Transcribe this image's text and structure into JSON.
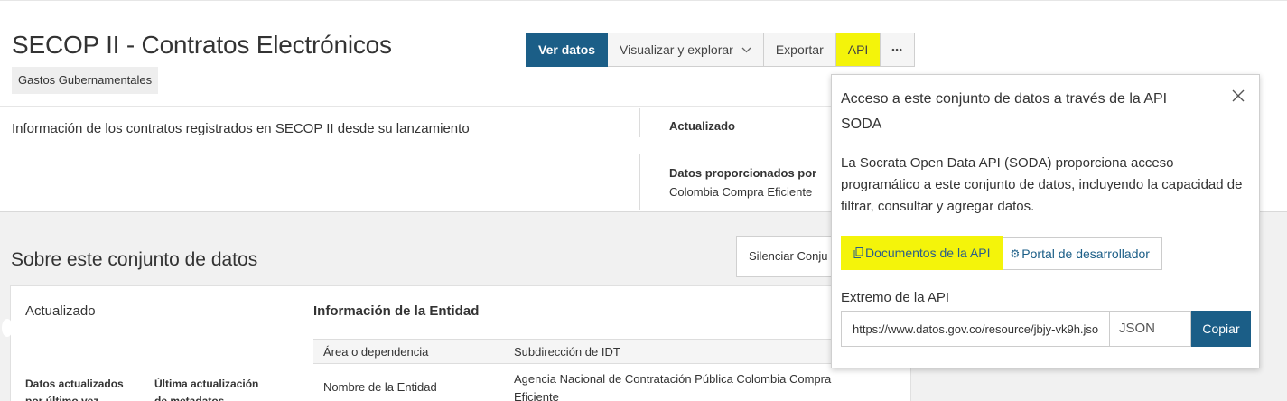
{
  "header": {
    "title": "SECOP II - Contratos Electrónicos",
    "category_tag": "Gastos Gubernamentales"
  },
  "toolbar": {
    "view_data": "Ver datos",
    "visualize": "Visualizar y explorar",
    "export": "Exportar",
    "api": "API",
    "more": "•••"
  },
  "summary": {
    "description": "Información de los contratos registrados en SECOP II desde su lanzamiento",
    "updated_label": "Actualizado",
    "provided_by_label": "Datos proporcionados por",
    "provided_by_value": "Colombia Compra Eficiente"
  },
  "about": {
    "title": "Sobre este conjunto de datos",
    "mute_button": "Silenciar Conju",
    "updated": "Actualizado",
    "data_updated_label": "Datos actualizados por último vez",
    "metadata_updated_label": "Última actualización de metadatos",
    "entity_info_title": "Información de la Entidad",
    "table": [
      {
        "key": "Área o dependencia",
        "value": "Subdirección de IDT"
      },
      {
        "key": "Nombre de la Entidad",
        "value": "Agencia Nacional de Contratación Pública Colombia Compra Eficiente"
      }
    ]
  },
  "api_popover": {
    "title": "Acceso a este conjunto de datos a través de la API SODA",
    "description": "La Socrata Open Data API (SODA) proporciona acceso programático a este conjunto de datos, incluyendo la capacidad de filtrar, consultar y agregar datos.",
    "docs_button": "Documentos de la API",
    "dev_portal_button": "Portal de desarrollador",
    "endpoint_label": "Extremo de la API",
    "endpoint_url": "https://www.datos.gov.co/resource/jbjy-vk9h.json",
    "format": "JSON",
    "copy_button": "Copiar"
  },
  "colors": {
    "primary": "#1b5e87",
    "highlight": "#f4f40a"
  },
  "icons": {
    "close": "close-icon",
    "docs": "documents-icon",
    "portal": "gear-icon",
    "chevron": "chevron-down-icon"
  }
}
